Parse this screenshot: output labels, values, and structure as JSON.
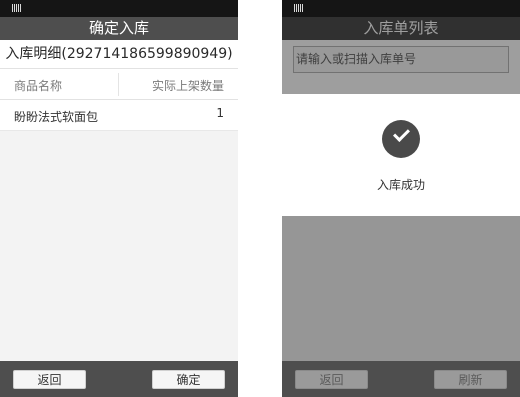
{
  "left_screen": {
    "title": "确定入库",
    "detail_title": "入库明细(292714186599890949)",
    "table": {
      "columns": [
        "商品名称",
        "实际上架数量"
      ],
      "rows": [
        {
          "name": "盼盼法式软面包",
          "qty": "1"
        }
      ]
    },
    "buttons": {
      "back": "返回",
      "confirm": "确定"
    }
  },
  "right_screen": {
    "title": "入库单列表",
    "search_placeholder": "请输入或扫描入库单号",
    "toast": {
      "icon": "check-icon",
      "message": "入库成功"
    },
    "buttons": {
      "back": "返回",
      "refresh": "刷新"
    }
  },
  "colors": {
    "status_bar": "#151515",
    "title_bar": "#4e4e4e",
    "bottom_bar": "#4e4e4e",
    "check_circle": "#4a4a4a"
  }
}
